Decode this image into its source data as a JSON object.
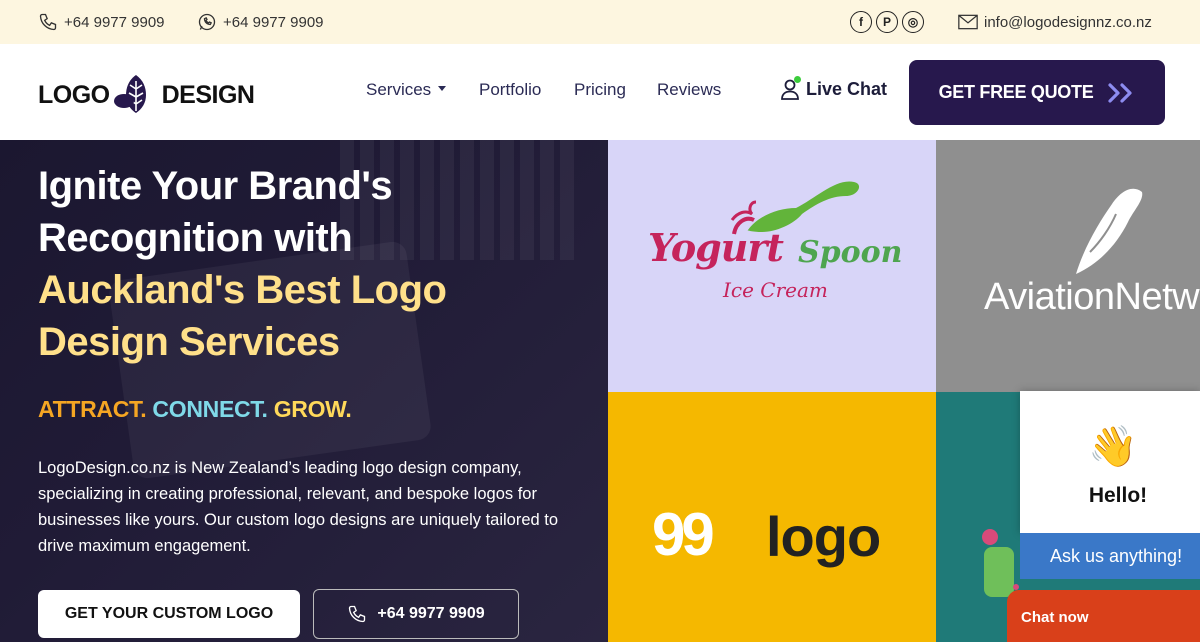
{
  "topbar": {
    "phone1": "+64 9977 9909",
    "phone2": "+64 9977 9909",
    "email": "info@logodesignnz.co.nz",
    "social": [
      "f",
      "P",
      "◎"
    ]
  },
  "nav": {
    "logo_left": "LOGO",
    "logo_right": "DESIGN",
    "items": [
      {
        "label": "Services"
      },
      {
        "label": "Portfolio"
      },
      {
        "label": "Pricing"
      },
      {
        "label": "Reviews"
      }
    ],
    "live_chat": "Live Chat",
    "quote_button": "GET FREE QUOTE"
  },
  "hero": {
    "line1": "Ignite Your Brand's",
    "line2": "Recognition with",
    "line3": "Auckland's Best Logo",
    "line4": "Design Services",
    "tagline": [
      "ATTRACT.",
      "CONNECT.",
      "GROW."
    ],
    "description": "LogoDesign.co.nz is New Zealand’s leading logo design company, specializing in creating professional, relevant, and bespoke logos for businesses like yours. Our custom logo designs are uniquely tailored to drive maximum engagement.",
    "cta_primary": "GET YOUR CUSTOM LOGO",
    "cta_phone": "+64 9977 9909"
  },
  "portfolio": {
    "tile1_a": "Yogurt",
    "tile1_b": "Spoon",
    "tile1_c": "Ice Cream",
    "tile2": "AviationNetwork",
    "tile3_nums": "99",
    "tile3_word": "logo"
  },
  "chat": {
    "wave": "👋",
    "hello": "Hello!",
    "ask": "Ask us anything!",
    "chat_now": "Chat now"
  },
  "colors": {
    "navy": "#27184d",
    "hero_yellow": "#ffe08a",
    "tag_orange": "#f5a623",
    "tag_cyan": "#7fd9e8",
    "tag_yellow": "#ffd95a",
    "chat_blue": "#3a78c8",
    "chat_orange": "#d9401a"
  }
}
